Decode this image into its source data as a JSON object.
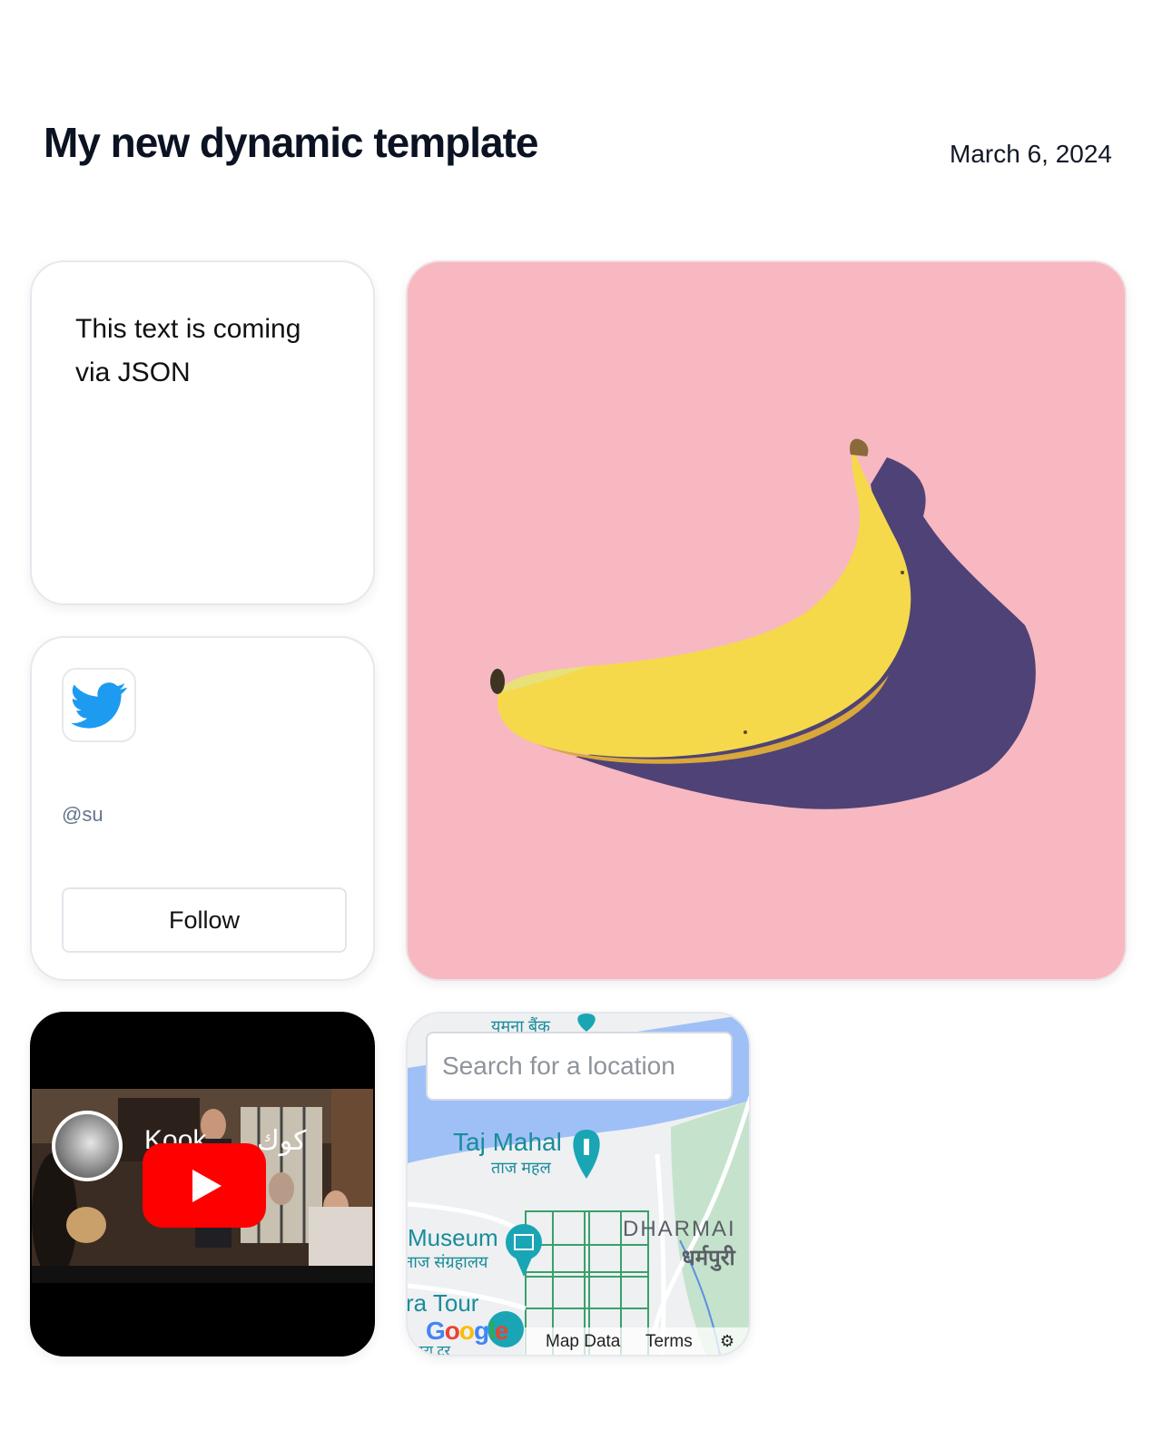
{
  "header": {
    "title": "My new dynamic template",
    "date": "March 6, 2024"
  },
  "text_card": {
    "text": "This text is coming via JSON"
  },
  "twitter_card": {
    "icon": "twitter-bird-icon",
    "handle": "@su",
    "follow_label": "Follow",
    "brand_color": "#1d9bf0"
  },
  "video_card": {
    "title_latin": "Kook",
    "title_arabic": "كوك",
    "play_icon": "youtube-play-icon",
    "play_color": "#ff0000"
  },
  "map_card": {
    "search_placeholder": "Search for a location",
    "labels": {
      "bank": "यमना बैंक",
      "taj_mahal": "Taj Mahal",
      "taj_mahal_hi": "ताज महल",
      "museum": "Museum",
      "museum_hi": "ताज संग्रहालय",
      "dharma": "DHARMAI",
      "dharma_hi": "धर्मपुरी",
      "tour": "ra Tour",
      "tour_hi": "आगरा टूर"
    },
    "logo": "Google",
    "map_data_label": "Map Data",
    "terms_label": "Terms"
  },
  "colors": {
    "banana_background": "#f7b8c2",
    "map_water": "#9fc0f7",
    "map_park": "#c5e3cc"
  }
}
